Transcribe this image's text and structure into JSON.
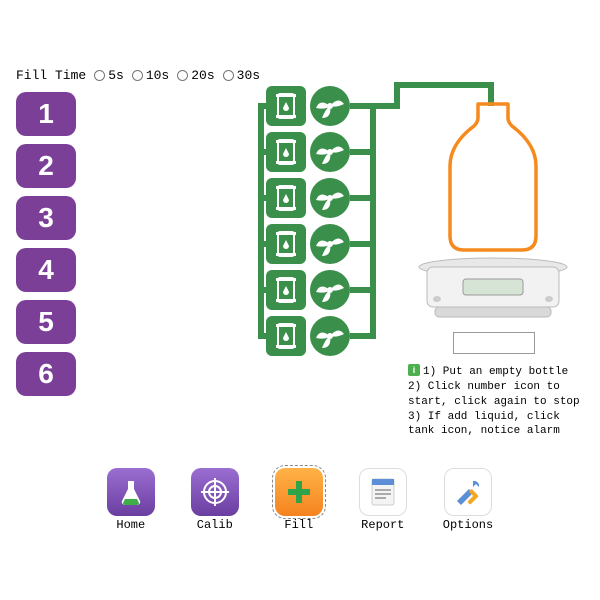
{
  "fill_time": {
    "label": "Fill Time",
    "options": [
      "5s",
      "10s",
      "20s",
      "30s"
    ]
  },
  "channels": [
    "1",
    "2",
    "3",
    "4",
    "5",
    "6"
  ],
  "weight_value": "",
  "instructions": {
    "line1": "1) Put an empty bottle",
    "line2": "2) Click number icon to start, click again to stop",
    "line3": "3) If add liquid, click tank icon, notice alarm"
  },
  "nav": {
    "home": "Home",
    "calib": "Calib",
    "fill": "Fill",
    "report": "Report",
    "options": "Options"
  },
  "colors": {
    "channel": "#7b3f98",
    "pump": "#3a8f4a",
    "fill_icon": "#f58a1f",
    "bottle_outline": "#f58a1f"
  }
}
